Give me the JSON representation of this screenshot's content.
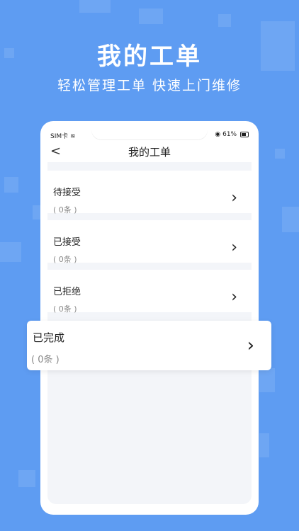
{
  "hero": {
    "title": "我的工单",
    "subtitle": "轻松管理工单 快速上门维修"
  },
  "phone": {
    "status_carrier": "SIM卡",
    "status_battery": "61%",
    "nav_title": "我的工单",
    "back_glyph": "<"
  },
  "orders": [
    {
      "title": "待接受",
      "count": "( 0条 )"
    },
    {
      "title": "已接受",
      "count": "( 0条 )"
    },
    {
      "title": "已拒绝",
      "count": "( 0条 )"
    }
  ],
  "featured": {
    "title": "已完成",
    "count": "( 0条 )"
  },
  "icons": {
    "chevron": "chevron-right-icon",
    "back": "back-arrow-icon",
    "wifi": "wifi-icon",
    "battery": "battery-icon"
  },
  "colors": {
    "background": "#5e9cf2",
    "card": "#ffffff",
    "list_bg": "#f3f5f9"
  }
}
